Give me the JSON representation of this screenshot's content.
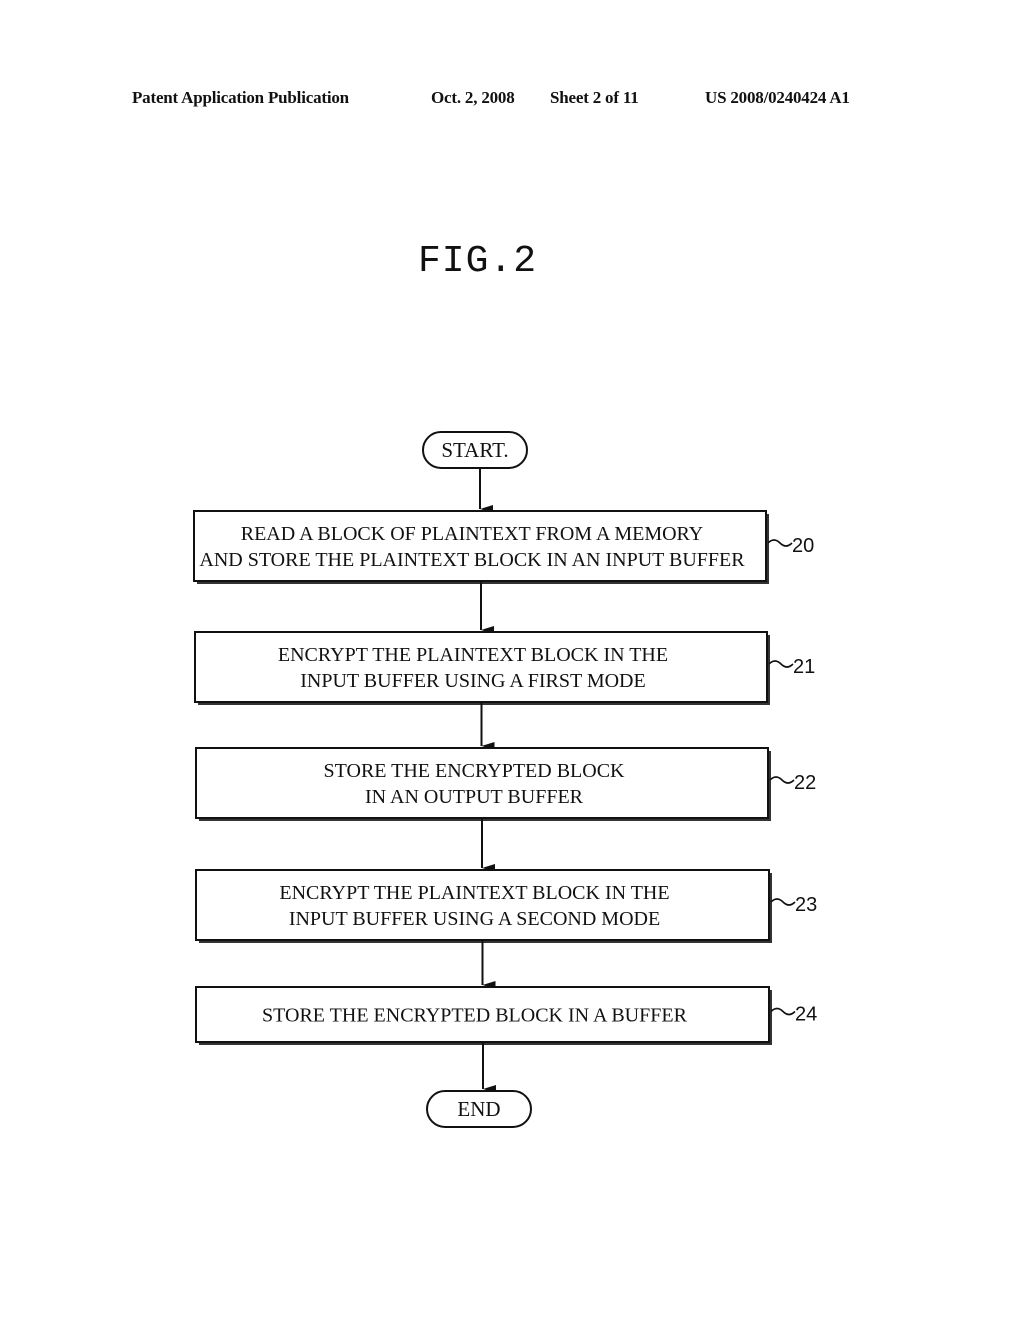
{
  "header": {
    "publication": "Patent Application Publication",
    "date": "Oct. 2, 2008",
    "sheet": "Sheet 2 of 11",
    "number": "US 2008/0240424 A1"
  },
  "figure": {
    "title": "FIG.2",
    "start_label": "START.",
    "end_label": "END",
    "steps": [
      {
        "ref": "20",
        "lines": [
          "READ A BLOCK OF PLAINTEXT FROM A MEMORY",
          "AND STORE THE PLAINTEXT BLOCK IN AN INPUT BUFFER"
        ]
      },
      {
        "ref": "21",
        "lines": [
          "ENCRYPT THE PLAINTEXT BLOCK IN THE",
          "INPUT BUFFER USING A FIRST MODE"
        ]
      },
      {
        "ref": "22",
        "lines": [
          "STORE THE ENCRYPTED BLOCK",
          "IN AN OUTPUT BUFFER"
        ]
      },
      {
        "ref": "23",
        "lines": [
          "ENCRYPT THE PLAINTEXT BLOCK IN THE",
          "INPUT BUFFER USING A SECOND MODE"
        ]
      },
      {
        "ref": "24",
        "lines": [
          "STORE THE ENCRYPTED BLOCK IN A BUFFER"
        ]
      }
    ]
  }
}
